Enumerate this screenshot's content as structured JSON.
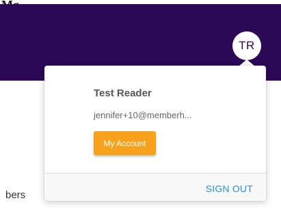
{
  "page": {
    "top_text_fragment": "Mg",
    "background_text": "bers"
  },
  "header": {
    "background_color": "#2c0856",
    "avatar_initials": "TR"
  },
  "user_menu": {
    "name": "Test Reader",
    "email": "jennifer+10@memberh...",
    "account_button_label": "My Account",
    "account_button_color": "#f7a21b",
    "sign_out_label": "SIGN OUT",
    "sign_out_color": "#2f8fd8"
  }
}
